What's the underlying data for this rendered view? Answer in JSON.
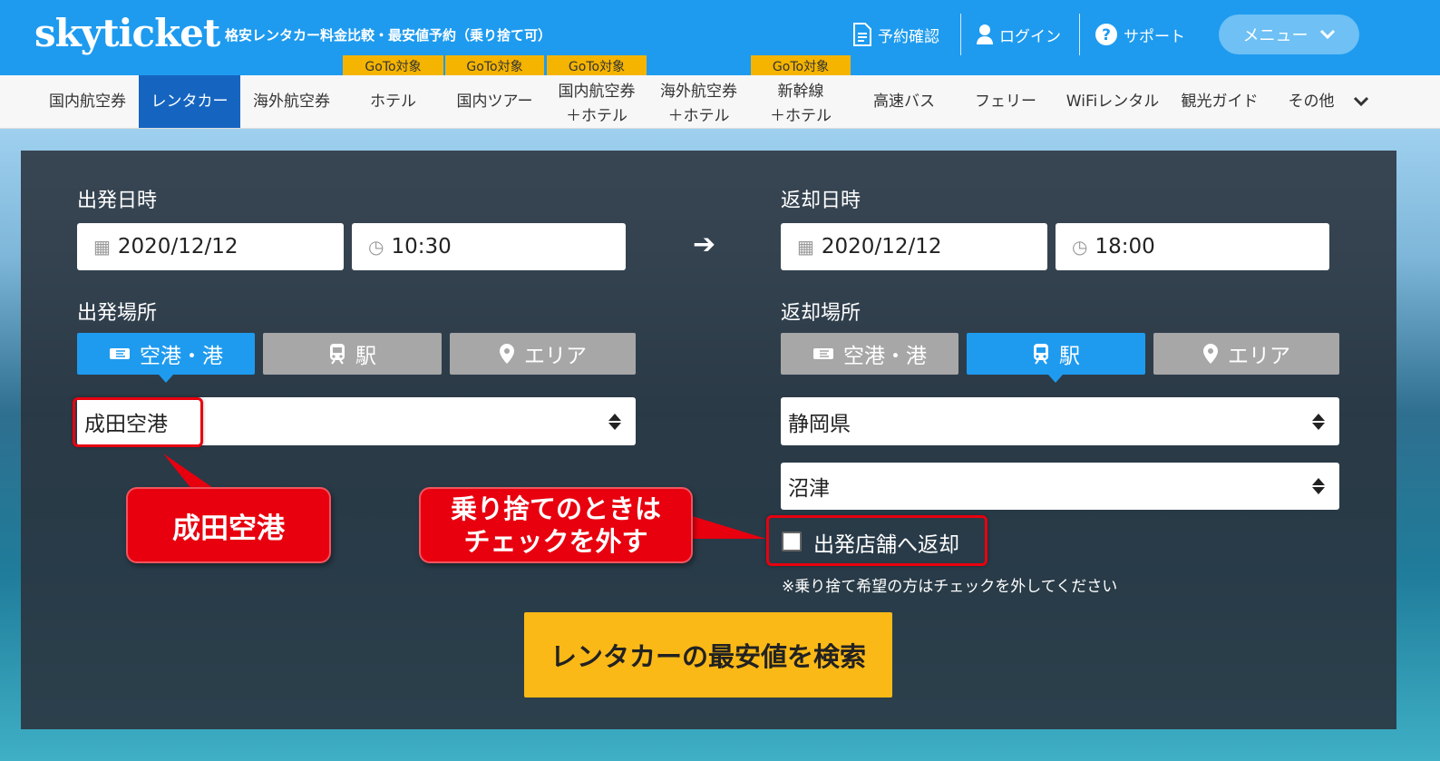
{
  "header": {
    "logo": "skyticket",
    "tagline": "格安レンタカー料金比較・最安値予約（乗り捨て可）",
    "links": [
      {
        "label": "予約確認",
        "icon": "document-icon"
      },
      {
        "label": "ログイン",
        "icon": "user-icon"
      },
      {
        "label": "サポート",
        "icon": "help-icon"
      }
    ],
    "menu_label": "メニュー"
  },
  "nav": {
    "items": [
      {
        "label1": "国内航空券",
        "label2": ""
      },
      {
        "label1": "レンタカー",
        "label2": ""
      },
      {
        "label1": "海外航空券",
        "label2": ""
      },
      {
        "label1": "ホテル",
        "label2": ""
      },
      {
        "label1": "国内ツアー",
        "label2": ""
      },
      {
        "label1": "国内航空券",
        "label2": "＋ホテル"
      },
      {
        "label1": "海外航空券",
        "label2": "＋ホテル"
      },
      {
        "label1": "新幹線",
        "label2": "＋ホテル"
      },
      {
        "label1": "高速バス",
        "label2": ""
      },
      {
        "label1": "フェリー",
        "label2": ""
      },
      {
        "label1": "WiFiレンタル",
        "label2": ""
      },
      {
        "label1": "観光ガイド",
        "label2": ""
      },
      {
        "label1": "その他",
        "label2": ""
      }
    ],
    "goto_badge": "GoTo対象",
    "active_index": 1
  },
  "form": {
    "departure": {
      "label": "出発日時",
      "date": "2020/12/12",
      "time": "10:30"
    },
    "return": {
      "label": "返却日時",
      "date": "2020/12/12",
      "time": "18:00"
    },
    "departure_place": {
      "label": "出発場所",
      "tabs": [
        "空港・港",
        "駅",
        "エリア"
      ],
      "active_tab": 0,
      "value": "成田空港"
    },
    "return_place": {
      "label": "返却場所",
      "tabs": [
        "空港・港",
        "駅",
        "エリア"
      ],
      "active_tab": 1,
      "prefecture": "静岡県",
      "station": "沼津"
    },
    "same_store_label": "出発店舗へ返却",
    "same_store_checked": false,
    "note": "※乗り捨て希望の方はチェックを外してください",
    "search_button": "レンタカーの最安値を検索"
  },
  "annotations": {
    "callout1": "成田空港",
    "callout2_line1": "乗り捨てのときは",
    "callout2_line2": "チェックを外す"
  },
  "colors": {
    "brand_blue": "#1e9bef",
    "nav_active": "#1565c0",
    "goto_yellow": "#f5b400",
    "search_yellow": "#fbb917",
    "annotation_red": "#e8000f"
  }
}
